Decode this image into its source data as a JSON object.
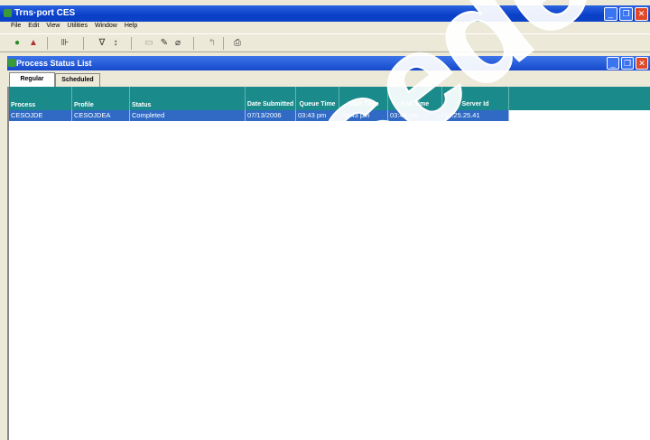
{
  "app": {
    "title": "Trns·port CES"
  },
  "menu": [
    "File",
    "Edit",
    "View",
    "Utilities",
    "Window",
    "Help"
  ],
  "toolbar": [
    "green-arrow-icon",
    "chart-icon",
    "tree-icon",
    "filter-icon",
    "sort-icon",
    "folder-icon",
    "edit-icon",
    "eraser-icon",
    "help-icon",
    "printer-icon"
  ],
  "child": {
    "title": "Process Status List"
  },
  "tabs": [
    {
      "label": "Regular"
    },
    {
      "label": "Scheduled"
    }
  ],
  "columns": [
    "Process",
    "Profile",
    "Status",
    "Date Submitted",
    "Queue Time",
    "Start Time",
    "End Time",
    "Server Id"
  ],
  "rows": [
    {
      "process": "CESOJDE",
      "profile": "CESOJDEA",
      "status": "Completed",
      "date": "07/13/2006",
      "queue": "03:43 pm",
      "start": "03:43 pm",
      "end": "03:44 pm",
      "server": "10.25.25.41"
    }
  ],
  "watermark": "Superseded",
  "colors": {
    "header": "#1a8a8a",
    "selected_row": "#316ac5",
    "titlebar": "#0a3fc7"
  }
}
